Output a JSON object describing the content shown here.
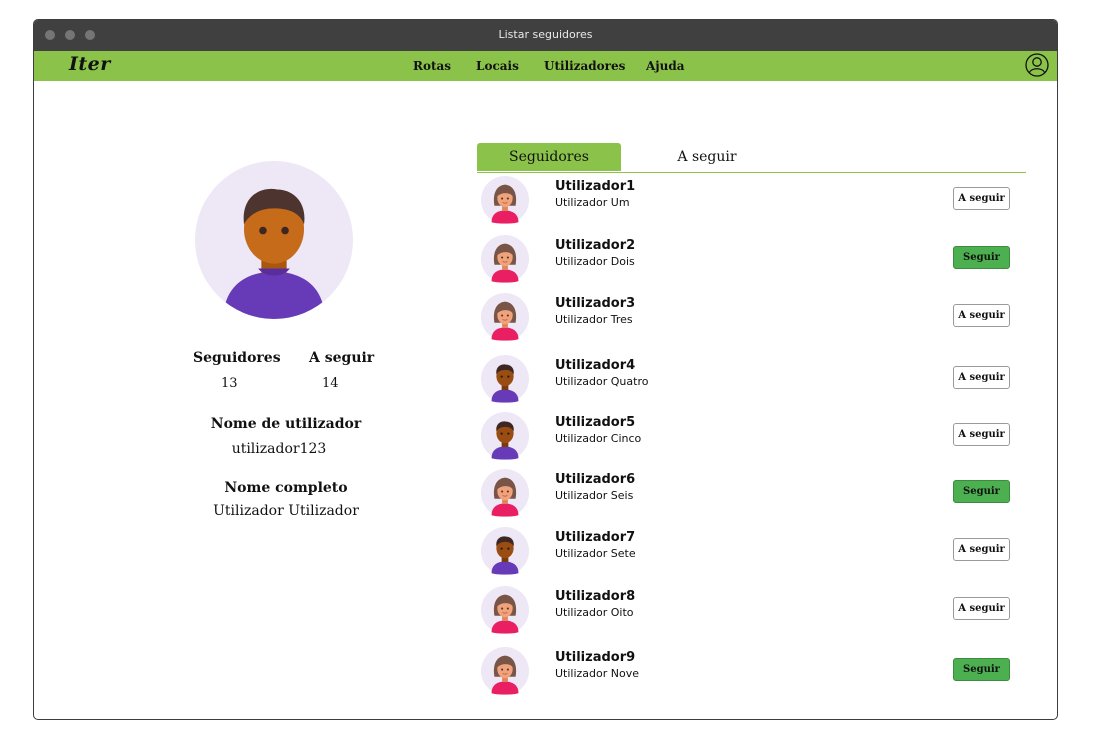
{
  "window": {
    "title": "Listar seguidores"
  },
  "navbar": {
    "logo": "Iter",
    "links": [
      "Rotas",
      "Locais",
      "Utilizadores",
      "Ajuda"
    ],
    "accent": "#8bc34a"
  },
  "profile": {
    "followers_label": "Seguidores",
    "followers_count": "13",
    "following_label": "A seguir",
    "following_count": "14",
    "username_label": "Nome de utilizador",
    "username": "utilizador123",
    "fullname_label": "Nome completo",
    "fullname": "Utilizador Utilizador"
  },
  "tabs": [
    {
      "label": "Seguidores",
      "active": true
    },
    {
      "label": "A seguir",
      "active": false
    }
  ],
  "users": [
    {
      "username": "Utilizador1",
      "fullname": "Utilizador Um",
      "avatar": "female-avatar-icon",
      "button": "A seguir",
      "state": "following"
    },
    {
      "username": "Utilizador2",
      "fullname": "Utilizador Dois",
      "avatar": "female-avatar-icon",
      "button": "Seguir",
      "state": "follow"
    },
    {
      "username": "Utilizador3",
      "fullname": "Utilizador Tres",
      "avatar": "female-avatar-icon",
      "button": "A seguir",
      "state": "following"
    },
    {
      "username": "Utilizador4",
      "fullname": "Utilizador Quatro",
      "avatar": "male-avatar-icon",
      "button": "A seguir",
      "state": "following"
    },
    {
      "username": "Utilizador5",
      "fullname": "Utilizador Cinco",
      "avatar": "male-avatar-icon",
      "button": "A seguir",
      "state": "following"
    },
    {
      "username": "Utilizador6",
      "fullname": "Utilizador Seis",
      "avatar": "female-avatar-icon",
      "button": "Seguir",
      "state": "follow"
    },
    {
      "username": "Utilizador7",
      "fullname": "Utilizador Sete",
      "avatar": "male-avatar-icon",
      "button": "A seguir",
      "state": "following"
    },
    {
      "username": "Utilizador8",
      "fullname": "Utilizador Oito",
      "avatar": "female-avatar-icon",
      "button": "A seguir",
      "state": "following"
    },
    {
      "username": "Utilizador9",
      "fullname": "Utilizador Nove",
      "avatar": "female-avatar-icon",
      "button": "Seguir",
      "state": "follow"
    }
  ]
}
